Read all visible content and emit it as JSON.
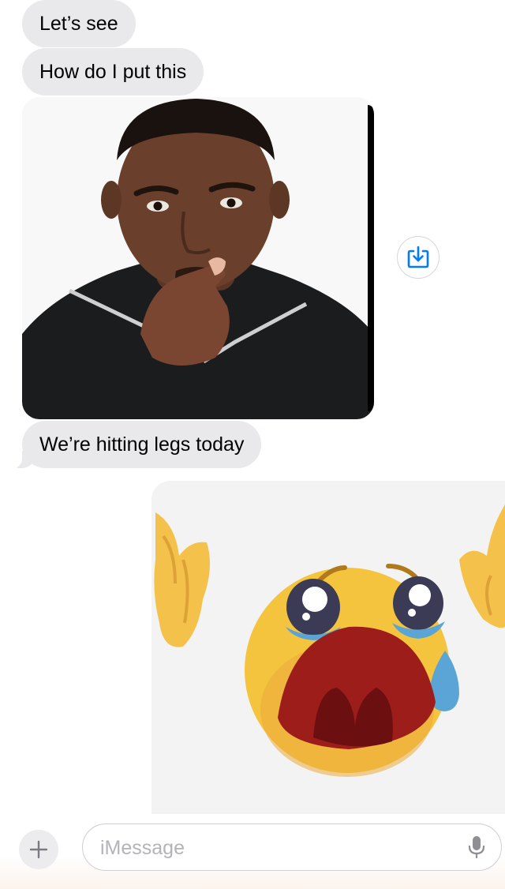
{
  "messages": [
    {
      "type": "text",
      "direction": "incoming",
      "text": "Let’s see"
    },
    {
      "type": "text",
      "direction": "incoming",
      "text": "How do I put this"
    },
    {
      "type": "image",
      "direction": "incoming",
      "description_icon": "thinking-man-photo"
    },
    {
      "type": "text",
      "direction": "incoming",
      "text": "We’re hitting legs today"
    },
    {
      "type": "image",
      "direction": "outgoing",
      "description_icon": "crying-emoji-sticker"
    }
  ],
  "actions": {
    "save_icon": "save-to-photos-icon"
  },
  "composer": {
    "placeholder": "iMessage",
    "plus_icon": "plus-icon",
    "mic_icon": "microphone-icon"
  },
  "colors": {
    "incoming_bubble": "#e9e9eb",
    "accent": "#007aff",
    "placeholder": "#b3b3b8"
  }
}
